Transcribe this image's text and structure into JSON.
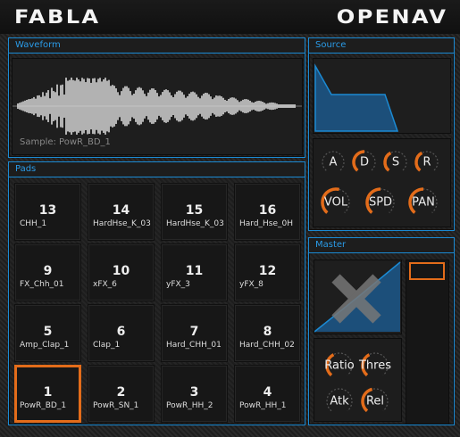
{
  "header": {
    "left_logo": "FABLA",
    "right_logo": "OPENAV"
  },
  "waveform": {
    "title": "Waveform",
    "sample_label": "Sample: PowR_BD_1"
  },
  "source": {
    "title": "Source",
    "knobs_row1": [
      "A",
      "D",
      "S",
      "R"
    ],
    "knobs_row2": [
      "VOL",
      "SPD",
      "PAN"
    ]
  },
  "pads": {
    "title": "Pads",
    "items": [
      {
        "num": "13",
        "name": "CHH_1"
      },
      {
        "num": "14",
        "name": "HardHse_K_03"
      },
      {
        "num": "15",
        "name": "HardHse_K_03"
      },
      {
        "num": "16",
        "name": "Hard_Hse_0H"
      },
      {
        "num": "9",
        "name": "FX_Chh_01"
      },
      {
        "num": "10",
        "name": "xFX_6"
      },
      {
        "num": "11",
        "name": "yFX_3"
      },
      {
        "num": "12",
        "name": "yFX_8"
      },
      {
        "num": "5",
        "name": "Amp_Clap_1"
      },
      {
        "num": "6",
        "name": "Clap_1"
      },
      {
        "num": "7",
        "name": "Hard_CHH_01"
      },
      {
        "num": "8",
        "name": "Hard_CHH_02"
      },
      {
        "num": "1",
        "name": "PowR_BD_1",
        "active": true
      },
      {
        "num": "2",
        "name": "PowR_SN_1"
      },
      {
        "num": "3",
        "name": "PowR_HH_2"
      },
      {
        "num": "4",
        "name": "PowR_HH_1"
      }
    ]
  },
  "master": {
    "title": "Master",
    "knobs": [
      "Ratio",
      "Thres",
      "Atk",
      "Rel"
    ]
  },
  "colors": {
    "accent": "#1b8ad3",
    "highlight": "#e36c1a",
    "bg": "#1e1e1e"
  },
  "icons": {
    "compressor_disabled": "x-icon"
  }
}
